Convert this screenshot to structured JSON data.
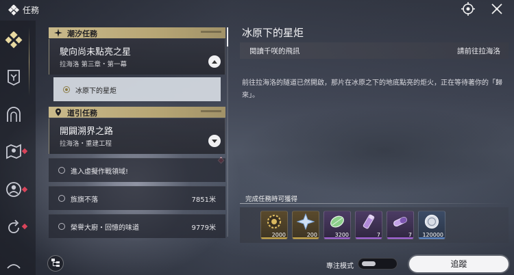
{
  "header": {
    "title": "任務"
  },
  "sidebar": {
    "items": [
      {
        "icon": "quest-diamond-icon",
        "active": true,
        "alert": false
      },
      {
        "icon": "banner-icon",
        "active": false,
        "alert": false
      },
      {
        "icon": "arch-icon",
        "active": false,
        "alert": false
      },
      {
        "icon": "map-icon",
        "active": false,
        "alert": true
      },
      {
        "icon": "person-circle-icon",
        "active": false,
        "alert": true
      },
      {
        "icon": "refresh-icon",
        "active": false,
        "alert": true
      }
    ]
  },
  "categories": {
    "tide": {
      "label": "潮汐任務",
      "quest": {
        "title": "駛向尚未點亮之星",
        "subtitle": "拉海洛 第三章・第一幕",
        "steps": [
          {
            "label": "冰原下的星炬",
            "selected": true
          }
        ]
      }
    },
    "guide": {
      "label": "道引任務",
      "quest": {
        "title": "開闢溯界之路",
        "subtitle": "拉海洛・重建工程",
        "steps": [
          {
            "label": "進入虛擬作戰領域!",
            "distance": "",
            "selected": false
          },
          {
            "label": "旌旗不落",
            "distance": "7851米",
            "selected": false
          },
          {
            "label": "榮譽大廚・回憶的味道",
            "distance": "9779米",
            "selected": false
          }
        ]
      }
    }
  },
  "detail": {
    "title": "冰原下的星炬",
    "objective": "閱讀千咲的飛訊",
    "location": "請前往拉海洛",
    "description": "前往拉海洛的隧道已然開啟，那片在冰原之下的地底點亮的炬火，正在等待著你的「歸來」。",
    "rewards_label": "完成任務時可獲得",
    "rewards": [
      {
        "icon": "gear-coin-icon",
        "count": "2000",
        "rarity": "gold",
        "color": "#c8a94a"
      },
      {
        "icon": "star-crystal-icon",
        "count": "200",
        "rarity": "gold",
        "color": "#c8a94a"
      },
      {
        "icon": "leaf-token-icon",
        "count": "3200",
        "rarity": "purple",
        "color": "#a463d8"
      },
      {
        "icon": "potion-vial-icon",
        "count": "7",
        "rarity": "purple",
        "color": "#a463d8"
      },
      {
        "icon": "capsule-icon",
        "count": "7",
        "rarity": "purple",
        "color": "#a463d8"
      },
      {
        "icon": "shell-coin-icon",
        "count": "120000",
        "rarity": "blue",
        "color": "#5a86c8"
      }
    ]
  },
  "footer": {
    "focus_label": "專注模式",
    "track_label": "追蹤"
  }
}
